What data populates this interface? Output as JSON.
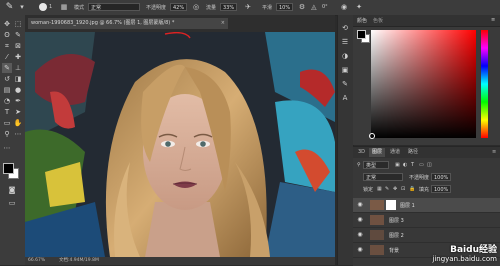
{
  "options_bar": {
    "brush_size": "1",
    "mode_label": "模式",
    "mode_value": "正常",
    "opacity_label": "不透明度",
    "opacity_value": "42%",
    "flow_label": "流量",
    "flow_value": "33%",
    "smooth_label": "平滑",
    "smooth_value": "10%",
    "angle_value": "0°"
  },
  "document": {
    "tab_title": "woman-1990683_1920.jpg @ 66.7% (图层 1, 图层蒙版/8) *",
    "zoom": "66.67%",
    "doc_size": "文档:4.94M/19.8M"
  },
  "color_panel": {
    "tabs": [
      "颜色",
      "色板"
    ],
    "fg_color": "#000000",
    "bg_color": "#ffffff"
  },
  "layers_panel": {
    "tabs": [
      "3D",
      "图层",
      "通道",
      "路径"
    ],
    "kind_label": "类型",
    "blend_mode": "正常",
    "opacity_label": "不透明度",
    "opacity_value": "100%",
    "lock_label": "锁定",
    "fill_label": "填充",
    "fill_value": "100%",
    "layers": [
      {
        "name": "图层 1",
        "selected": true
      },
      {
        "name": "图层 3",
        "selected": false
      },
      {
        "name": "图层 2",
        "selected": false
      },
      {
        "name": "背景",
        "selected": false
      }
    ]
  },
  "watermark": {
    "brand": "Baidu经验",
    "url": "jingyan.baidu.com"
  }
}
